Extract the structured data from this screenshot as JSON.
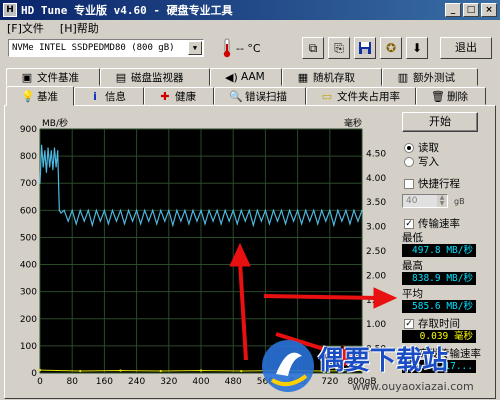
{
  "window": {
    "title": "HD Tune 专业版 v4.60 - 硬盘专业工具",
    "min": "_",
    "max": "□",
    "close": "×"
  },
  "menu": [
    "[F]文件",
    "[H]帮助"
  ],
  "toolbar": {
    "drive": "NVMe   INTEL SSDPEDMD80 (800 gB)",
    "temperature": "-- °C",
    "exit_label": "退出",
    "icons": [
      "copy-icon",
      "copy-text-icon",
      "save-icon",
      "options-icon",
      "download-icon"
    ]
  },
  "tabs_row1": [
    {
      "label": "文件基准",
      "icon": "file-benchmark-icon"
    },
    {
      "label": "磁盘监视器",
      "icon": "disk-monitor-icon"
    },
    {
      "label": "AAM",
      "icon": "speaker-icon"
    },
    {
      "label": "随机存取",
      "icon": "random-access-icon"
    },
    {
      "label": "额外测试",
      "icon": "extra-tests-icon"
    }
  ],
  "tabs_row2": [
    {
      "label": "基准",
      "icon": "bulb-icon",
      "active": true
    },
    {
      "label": "信息",
      "icon": "info-icon"
    },
    {
      "label": "健康",
      "icon": "health-icon"
    },
    {
      "label": "错误扫描",
      "icon": "scan-icon"
    },
    {
      "label": "文件夹占用率",
      "icon": "folder-icon"
    },
    {
      "label": "删除",
      "icon": "erase-icon"
    }
  ],
  "side": {
    "start_label": "开始",
    "read_label": "读取",
    "write_label": "写入",
    "short_stroke_label": "快捷行程",
    "short_stroke_value": "40",
    "short_stroke_unit": "gB",
    "transfer_rate_label": "传输速率",
    "min_label": "最低",
    "min_value": "497.8 MB/秒",
    "max_label": "最高",
    "max_value": "838.9 MB/秒",
    "avg_label": "平均",
    "avg_value": "585.6 MB/秒",
    "access_label": "存取时间",
    "access_value": "0.039 毫秒",
    "burst_label": "突发传输速率",
    "burst_value": "...217..."
  },
  "watermark": {
    "text": "偶要下载站",
    "url": "www.ouyaoxiazai.com"
  },
  "chart_data": {
    "type": "line",
    "ylabel_left": "MB/秒",
    "ylabel_right": "毫秒",
    "xlabel_unit": "gB",
    "x_ticks": [
      "0",
      "80",
      "160",
      "240",
      "320",
      "400",
      "480",
      "560",
      "640",
      "720",
      "800gB"
    ],
    "y_ticks_left": [
      "0",
      "100",
      "200",
      "300",
      "400",
      "500",
      "600",
      "700",
      "800",
      "900"
    ],
    "y_ticks_right": [
      "0.50",
      "1.00",
      "1.50",
      "2.00",
      "2.50",
      "3.00",
      "3.50",
      "4.00",
      "4.50"
    ],
    "xlim": [
      0,
      800
    ],
    "ylim_left": [
      0,
      900
    ],
    "ylim_right": [
      0,
      5.0
    ],
    "grid": true,
    "series": [
      {
        "color": "#4fb8e0",
        "x": [
          0,
          4,
          8,
          12,
          16,
          20,
          24,
          28,
          32,
          36,
          40,
          44,
          48,
          52,
          56,
          60,
          70,
          80,
          90,
          100,
          110,
          120,
          130,
          140,
          150,
          160,
          170,
          180,
          190,
          200,
          210,
          220,
          230,
          240,
          250,
          260,
          270,
          280,
          290,
          300,
          310,
          320,
          330,
          340,
          350,
          360,
          370,
          380,
          390,
          400,
          410,
          420,
          430,
          440,
          450,
          460,
          470,
          480,
          490,
          500,
          510,
          520,
          530,
          540,
          550,
          560,
          570,
          580,
          590,
          600,
          610,
          620,
          630,
          640,
          650,
          660,
          670,
          680,
          690,
          700,
          710,
          720,
          730,
          740,
          750,
          760,
          770,
          780,
          790,
          800
        ],
        "values": [
          700,
          840,
          760,
          820,
          740,
          830,
          760,
          820,
          750,
          830,
          760,
          820,
          600,
          590,
          595,
          600,
          560,
          600,
          550,
          600,
          560,
          600,
          545,
          600,
          560,
          600,
          550,
          600,
          560,
          600,
          550,
          600,
          560,
          600,
          550,
          600,
          560,
          600,
          550,
          600,
          560,
          600,
          545,
          600,
          560,
          600,
          550,
          600,
          560,
          600,
          550,
          600,
          560,
          600,
          550,
          600,
          560,
          600,
          550,
          600,
          560,
          600,
          545,
          600,
          560,
          600,
          550,
          600,
          560,
          600,
          550,
          600,
          560,
          600,
          550,
          600,
          560,
          600,
          550,
          600,
          560,
          600,
          545,
          600,
          560,
          600,
          550,
          600,
          560,
          600
        ]
      },
      {
        "color": "#e0e000",
        "x": [
          0,
          100,
          200,
          300,
          400,
          500,
          600,
          700,
          800
        ],
        "values": [
          0.06,
          0.04,
          0.05,
          0.04,
          0.05,
          0.04,
          0.05,
          0.04,
          0.05
        ],
        "axis": "right"
      }
    ]
  }
}
